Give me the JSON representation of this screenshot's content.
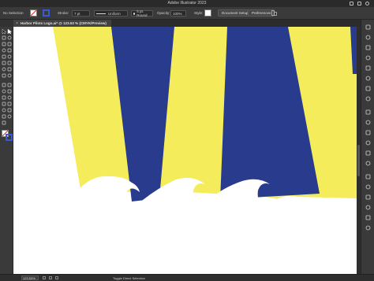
{
  "window": {
    "title": "Adobe Illustrator 2023"
  },
  "control_bar": {
    "selection_label": "No Selection",
    "stroke_label": "Stroke:",
    "stroke_weight": "7 pt",
    "profile": "Uniform",
    "brush": "5 pt. Round",
    "opacity_label": "Opacity:",
    "opacity_value": "100%",
    "style_label": "Style:",
    "document_setup": "Document Setup",
    "preferences": "Preferences"
  },
  "document_tab": {
    "close": "×",
    "label": "Harbor Pilots Logo.ai* @ 123.53 % (CMYK/Preview)"
  },
  "status_bar": {
    "zoom": "123.53%",
    "tool_hint": "Toggle Direct Selection"
  },
  "colors": {
    "yellow": "#f4ec5a",
    "navy": "#283b8c",
    "ui_dark": "#3a3a3a"
  },
  "icons": {
    "toolbar": [
      "selection-tool-icon",
      "direct-selection-tool-icon",
      "magic-wand-icon",
      "lasso-icon",
      "pen-tool-icon",
      "curvature-icon",
      "type-tool-icon",
      "line-tool-icon",
      "rectangle-tool-icon",
      "paintbrush-icon",
      "shaper-icon",
      "pencil-icon",
      "eraser-icon",
      "rotate-icon",
      "scale-icon",
      "width-tool-icon",
      "free-transform-icon",
      "shape-builder-icon",
      "perspective-grid-icon",
      "mesh-icon",
      "gradient-icon",
      "eyedropper-icon",
      "blend-icon",
      "symbol-sprayer-icon",
      "graph-icon",
      "artboard-icon",
      "slice-icon",
      "hand-icon",
      "zoom-icon"
    ],
    "right_panel": [
      "properties-icon",
      "layers-icon",
      "libraries-icon",
      "color-icon",
      "swatches-icon",
      "brushes-icon",
      "symbols-icon",
      "stroke-icon",
      "gradient-panel-icon",
      "transparency-icon",
      "appearance-icon",
      "graphic-styles-icon",
      "align-icon",
      "pathfinder-icon",
      "transform-icon",
      "character-icon",
      "paragraph-icon",
      "links-icon",
      "artboards-icon",
      "asset-export-icon"
    ]
  }
}
